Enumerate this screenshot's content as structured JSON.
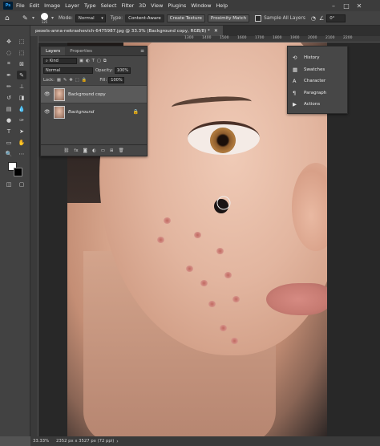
{
  "menubar": {
    "logo": "Ps",
    "items": [
      "File",
      "Edit",
      "Image",
      "Layer",
      "Type",
      "Select",
      "Filter",
      "3D",
      "View",
      "Plugins",
      "Window",
      "Help"
    ]
  },
  "options": {
    "brush_size": "125",
    "mode_label": "Mode:",
    "mode_value": "Normal",
    "type_label": "Type:",
    "type_buttons": [
      "Content-Aware",
      "Create Texture",
      "Proximity Match"
    ],
    "sample_all_layers": "Sample All Layers",
    "angle": "0°"
  },
  "document": {
    "tab_title": "pexels-anna-nekrashevich-6475987.jpg @ 33.3% (Background copy, RGB/8) *"
  },
  "ruler": {
    "h_labels": [
      "1300",
      "1400",
      "1500",
      "1600",
      "1700",
      "1800",
      "1900",
      "2000",
      "2100",
      "2200"
    ]
  },
  "layers": {
    "tabs": [
      "Layers",
      "Properties"
    ],
    "filter_kind": "Kind",
    "blend_mode": "Normal",
    "opacity_label": "Opacity:",
    "opacity_value": "100%",
    "lock_label": "Lock:",
    "fill_label": "Fill:",
    "fill_value": "100%",
    "items": [
      {
        "name": "Background copy"
      },
      {
        "name": "Background"
      }
    ]
  },
  "side_panel": {
    "items": [
      {
        "label": "History",
        "icon": "history-icon"
      },
      {
        "label": "Swatches",
        "icon": "swatches-icon"
      },
      {
        "label": "Character",
        "icon": "character-icon"
      },
      {
        "label": "Paragraph",
        "icon": "paragraph-icon"
      },
      {
        "label": "Actions",
        "icon": "actions-icon"
      }
    ]
  },
  "status": {
    "zoom": "33.33%",
    "dimensions": "2352 px x 3527 px (72 ppi)"
  }
}
